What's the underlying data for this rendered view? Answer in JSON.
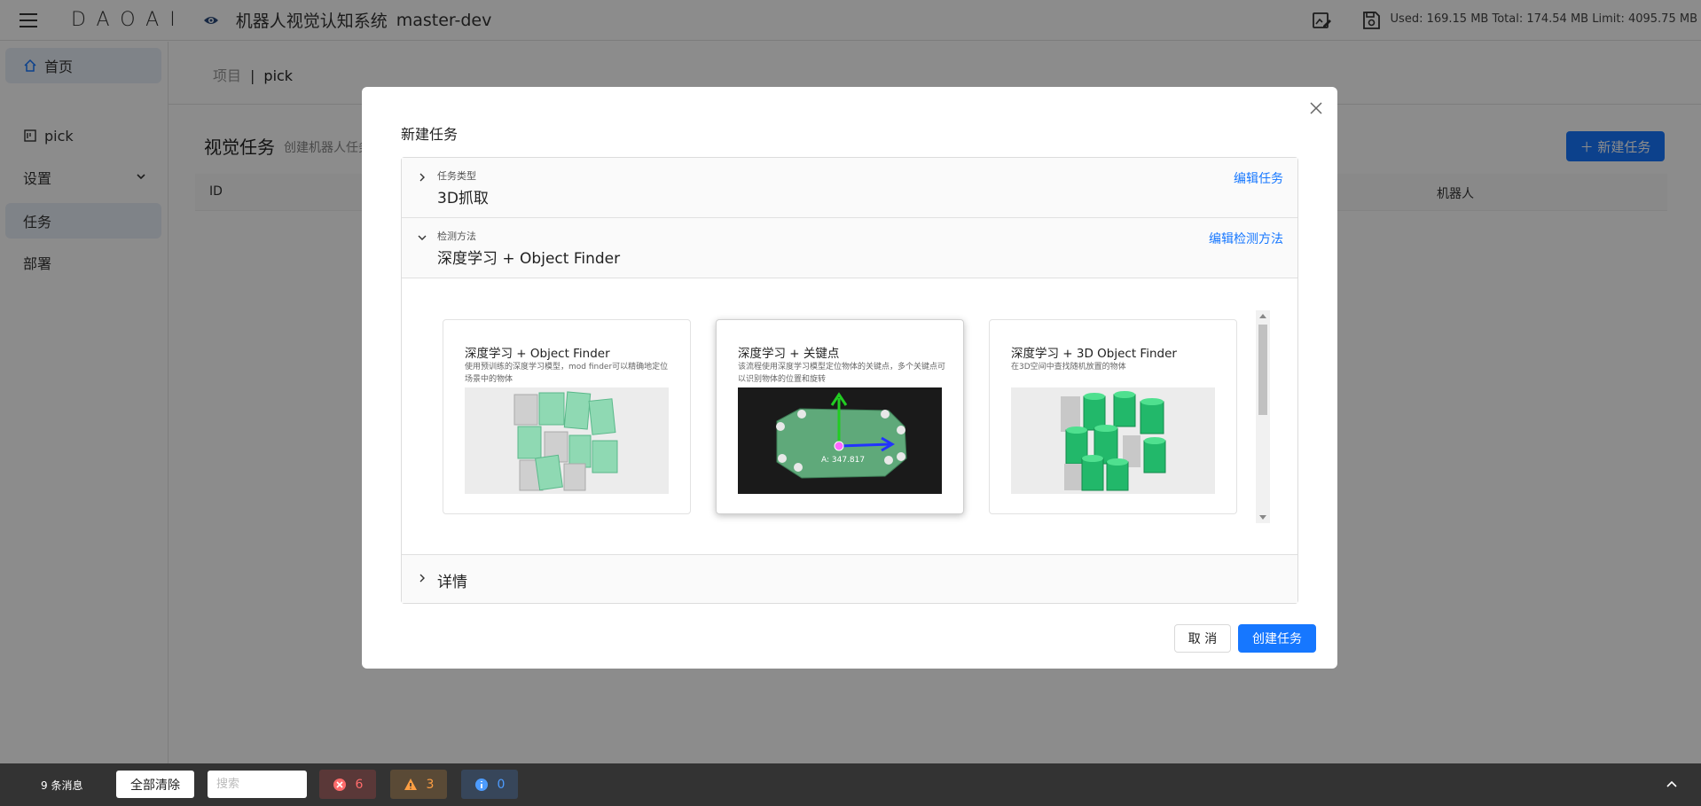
{
  "topbar": {
    "logo": "DAOAI",
    "app_title": "机器人视觉认知系统",
    "branch": "master-dev",
    "memory": "Used: 169.15 MB Total: 174.54 MB Limit: 4095.75 MB"
  },
  "sidebar": {
    "home": "首页",
    "project": "pick",
    "settings": "设置",
    "tasks": "任务",
    "deploy": "部署"
  },
  "main": {
    "breadcrumb_root": "项目",
    "breadcrumb_sep": "|",
    "breadcrumb_current": "pick",
    "section_title": "视觉任务",
    "section_subtitle": "创建机器人任务",
    "new_task_label": "＋ 新建任务",
    "table_headers": {
      "id": "ID",
      "robot": "机器人"
    }
  },
  "modal": {
    "title": "新建任务",
    "task_type": {
      "label": "任务类型",
      "value": "3D抓取",
      "edit": "编辑任务"
    },
    "method": {
      "label": "检测方法",
      "value": "深度学习 + Object Finder",
      "edit": "编辑检测方法"
    },
    "cards": [
      {
        "title": "深度学习 + Object Finder",
        "desc": "使用预训练的深度学习模型，mod finder可以精确地定位场景中的物体"
      },
      {
        "title": "深度学习 + 关键点",
        "desc": "该流程使用深度学习模型定位物体的关键点，多个关键点可以识别物体的位置和旋转",
        "image_label": "A: 347.817"
      },
      {
        "title": "深度学习 + 3D Object Finder",
        "desc": "在3D空间中查找随机放置的物体"
      }
    ],
    "details_label": "详情",
    "cancel_label": "取 消",
    "create_label": "创建任务"
  },
  "bottombar": {
    "message_count": "9 条消息",
    "clear_all": "全部清除",
    "search_placeholder": "搜索",
    "errors": "6",
    "warnings": "3",
    "infos": "0"
  },
  "colors": {
    "accent": "#1677ff",
    "error": "#ff6b6b",
    "warning": "#ff9f43",
    "info": "#4d9cff"
  }
}
